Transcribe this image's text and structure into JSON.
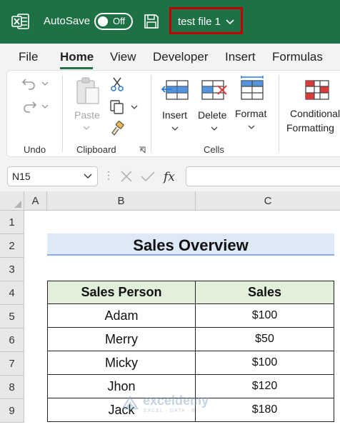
{
  "titlebar": {
    "app_icon": "excel-icon",
    "autosave_label": "AutoSave",
    "autosave_state": "Off",
    "save_icon": "save-icon",
    "filename": "test file 1",
    "brand_color": "#1e7145",
    "highlight_color": "#c00000"
  },
  "tabs": [
    "File",
    "Home",
    "View",
    "Developer",
    "Insert",
    "Formulas"
  ],
  "active_tab": "Home",
  "ribbon": {
    "undo_group": "Undo",
    "clipboard_group": "Clipboard",
    "paste_label": "Paste",
    "cells_group": "Cells",
    "insert_label": "Insert",
    "delete_label": "Delete",
    "format_label": "Format",
    "conditional_line1": "Conditional",
    "conditional_line2": "Formatting"
  },
  "formula_bar": {
    "name_box": "N15",
    "fx": "fx",
    "formula": ""
  },
  "grid": {
    "columns": [
      "A",
      "B",
      "C"
    ],
    "rows": [
      "1",
      "2",
      "3",
      "4",
      "5",
      "6",
      "7",
      "8",
      "9"
    ],
    "title": "Sales Overview",
    "headers": [
      "Sales Person",
      "Sales"
    ],
    "data": [
      [
        "Adam",
        "$100"
      ],
      [
        "Merry",
        "$50"
      ],
      [
        "Micky",
        "$100"
      ],
      [
        "Jhon",
        "$120"
      ],
      [
        "Jack",
        "$180"
      ]
    ],
    "header_fill": "#e2efda",
    "title_fill": "#dde9f7"
  },
  "watermark": {
    "name": "exceldemy",
    "tagline": "EXCEL · DATA · BI"
  }
}
